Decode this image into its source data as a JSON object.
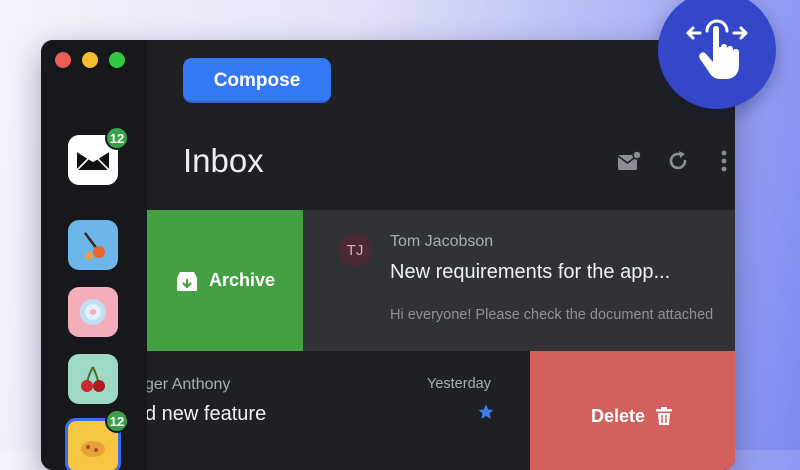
{
  "sidebar": {
    "apps": [
      {
        "name": "mail",
        "badge": "12",
        "color": "#ffffff"
      },
      {
        "name": "paint-tool",
        "color": "#6db6ea"
      },
      {
        "name": "disc",
        "color": "#f4aebb"
      },
      {
        "name": "cherries",
        "color": "#9ed9c6"
      },
      {
        "name": "food",
        "badge": "12",
        "color": "#f6c640"
      }
    ]
  },
  "toolbar": {
    "compose_label": "Compose"
  },
  "inbox": {
    "title": "Inbox",
    "header_icons": [
      "mark-mail-icon",
      "refresh-icon",
      "more-vertical-icon"
    ],
    "emails": [
      {
        "avatar": "TJ",
        "sender": "Tom Jacobson",
        "subject": "New requirements for the app...",
        "preview": "Hi everyone! Please check the document attached",
        "swipe_action": "Archive"
      },
      {
        "sender": "ger Anthony",
        "date": "Yesterday",
        "subject": "d new feature",
        "starred": true,
        "swipe_action": "Delete"
      }
    ]
  },
  "colors": {
    "accent": "#3478f6",
    "archive": "#43a043",
    "delete": "#d4605e",
    "badge": "#3aa14a",
    "touch_badge": "#3547c9"
  }
}
